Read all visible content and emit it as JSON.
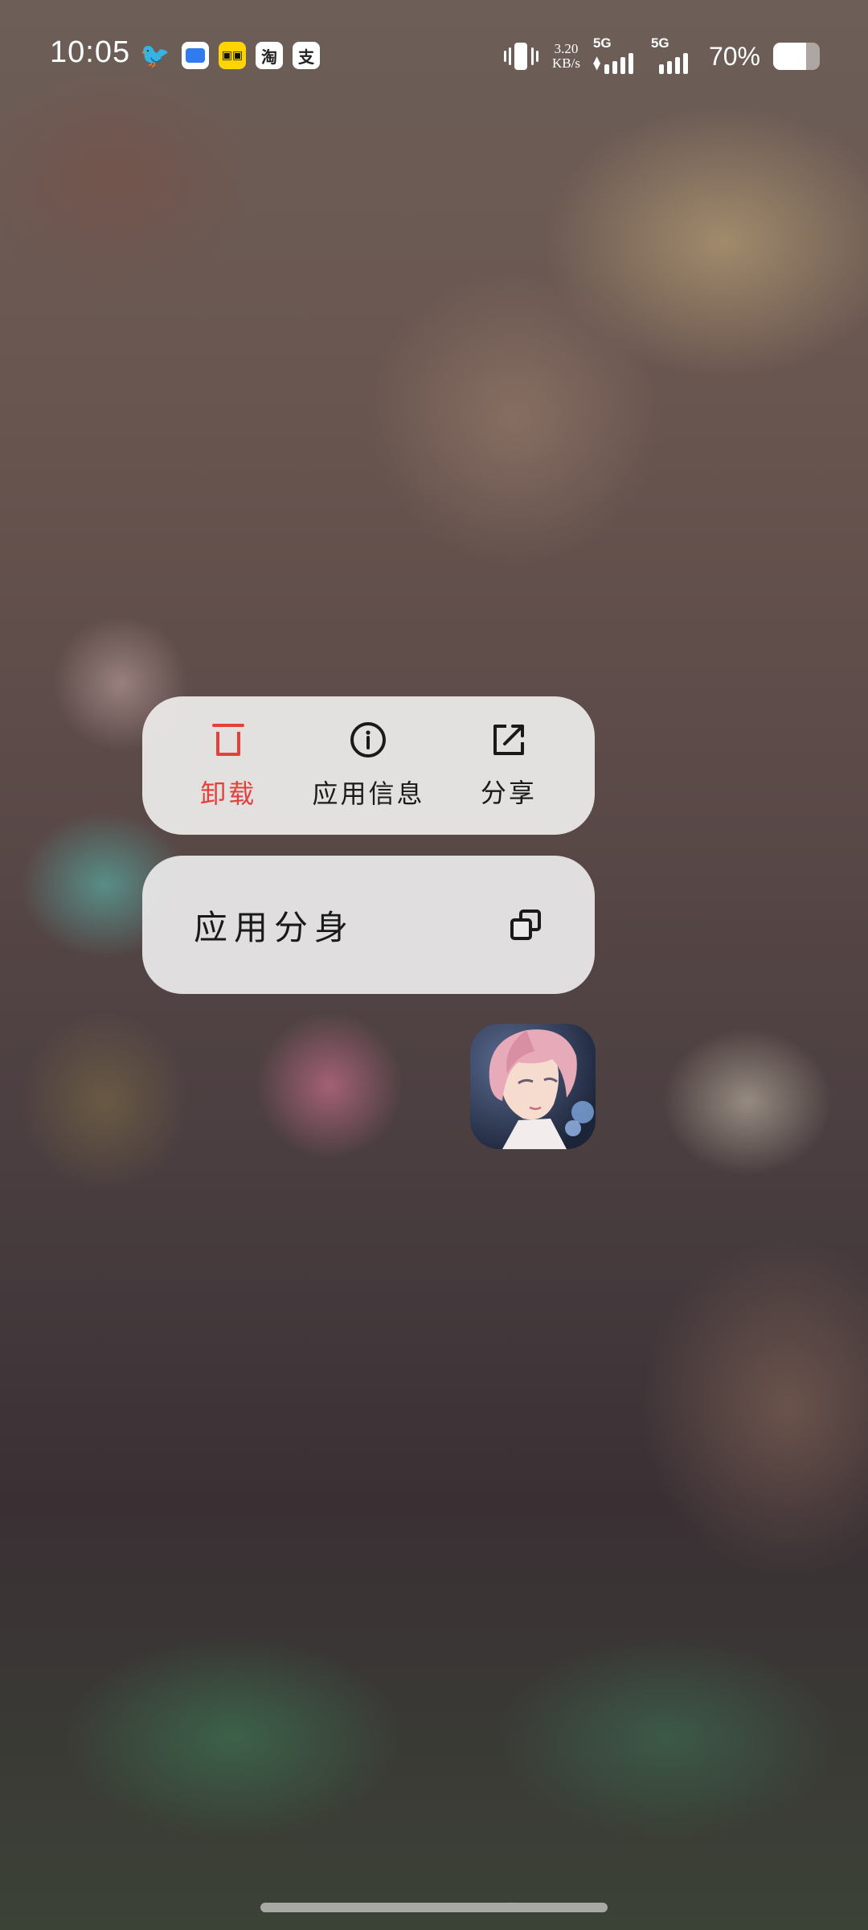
{
  "status_bar": {
    "time": "10:05",
    "notification_icons": [
      "bird-icon",
      "chat-app-icon",
      "yellow-app-icon",
      "taobao-icon",
      "alipay-icon"
    ],
    "notification_glyphs": {
      "bird": "🐦",
      "yellow": "▣▣",
      "taobao": "淘",
      "alipay": "支"
    },
    "net_speed_value": "3.20",
    "net_speed_unit": "KB/s",
    "sim1_tag": "5G",
    "sim2_tag": "5G",
    "battery_percent": "70%",
    "battery_level": 0.7
  },
  "context_menu": {
    "actions": [
      {
        "id": "uninstall",
        "label": "卸载",
        "icon": "trash-icon",
        "color": "#e5403a"
      },
      {
        "id": "app-info",
        "label": "应用信息",
        "icon": "info-icon"
      },
      {
        "id": "share",
        "label": "分享",
        "icon": "share-icon"
      }
    ],
    "clone": {
      "label": "应用分身",
      "icon": "clone-icon"
    }
  },
  "colors": {
    "danger": "#e5403a",
    "text": "#1a1a1a",
    "card_bg": "#eeecec"
  }
}
